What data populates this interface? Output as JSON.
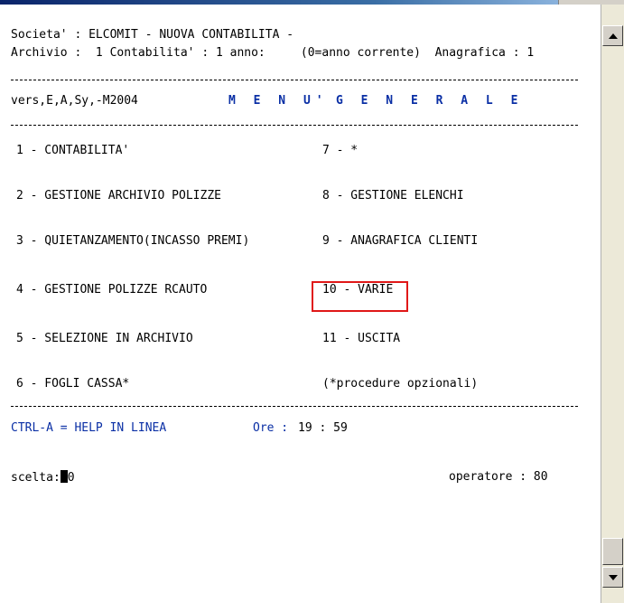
{
  "header": {
    "line1": "Societa' : ELCOMIT - NUOVA CONTABILITA -",
    "line2": "Archivio :  1 Contabilita' : 1 anno:     (0=anno corrente)  Anagrafica : 1",
    "version": "vers,E,A,Sy,-M2004",
    "menu_word": "M E N U'",
    "generale_word": "G E N E R A L E"
  },
  "menu": {
    "left": [
      "1 - CONTABILITA'",
      "2 - GESTIONE ARCHIVIO POLIZZE",
      "3 - QUIETANZAMENTO(INCASSO PREMI)",
      "4 - GESTIONE POLIZZE RCAUTO",
      "5 - SELEZIONE IN ARCHIVIO",
      "6 - FOGLI CASSA*"
    ],
    "right": [
      "7 - *",
      "8 - GESTIONE ELENCHI",
      "9 - ANAGRAFICA CLIENTI",
      "10 - VARIE",
      "11 - USCITA",
      "(*procedure opzionali)"
    ]
  },
  "footer": {
    "help": "CTRL-A = HELP IN LINEA",
    "time_label": "Ore :",
    "time_value": "19 : 59",
    "prompt": "scelta:",
    "input_value": "0",
    "operator": "operatore : 80"
  },
  "colors": {
    "accent_text": "#0a2fa5",
    "highlight_border": "#e01818"
  },
  "icons": {
    "scroll_up": "arrow-up-icon",
    "scroll_down": "arrow-down-icon"
  }
}
